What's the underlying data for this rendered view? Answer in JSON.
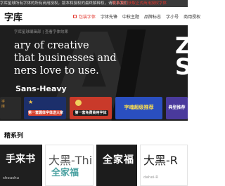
{
  "topbar": {
    "notice": "字库星球所有字体的所有商用授权，版本和授权的最终解释权，请联系我们",
    "notice_red": "联系我们获取正式商用授权字体"
  },
  "header": {
    "logo": "字库",
    "nav": [
      "包装字体",
      "字体先锋",
      "中秋主题",
      "品牌标志",
      "字小号",
      "商用授权"
    ]
  },
  "hero": {
    "breadcrumb": "字库星球编辑部  |  查看字体效果",
    "lines": [
      "ary of creative",
      "that businesses and",
      "ners love to use."
    ],
    "font_name": "Sans-Heavy",
    "side_text": "Z\nS",
    "watermark": "A"
  },
  "promos": [
    {
      "caption": "字\n库\n推\n荐"
    },
    {
      "caption": "第一套圆体字体送大家"
    },
    {
      "caption": "第一套免费商用字体"
    },
    {
      "caption": "字魂超级推荐"
    },
    {
      "caption": "典型推荐"
    }
  ],
  "section": {
    "title": "精系列"
  },
  "cards": [
    {
      "name": "手来书",
      "sub": "shoushu"
    },
    {
      "name": "大黑-Thin",
      "sub": "",
      "watermark": "全家福"
    },
    {
      "name": "全家福",
      "sub": ""
    },
    {
      "name": "大黑-R",
      "sub": "dahei-R"
    }
  ]
}
